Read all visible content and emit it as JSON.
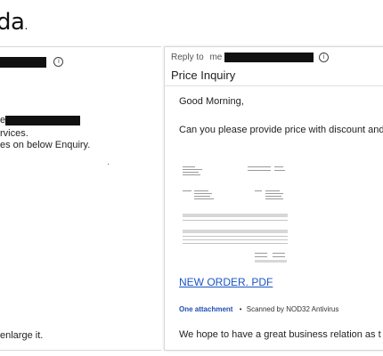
{
  "brand": {
    "logo_text": "da",
    "logo_dot": "."
  },
  "left_pane": {
    "line_1_suffix": "e",
    "line_2": "rvices.",
    "line_3": "es on below Enquiry.",
    "bullet": "·",
    "footer": "enlarge it."
  },
  "email": {
    "reply_to_label": "Reply to",
    "reply_to_me": "me",
    "subject": "Price Inquiry",
    "greeting": "Good Morning,",
    "body": "Can you please provide price with discount and lea",
    "attachment_link": "NEW ORDER. PDF",
    "attachment_count": "One attachment",
    "separator": "•",
    "scan_status": "Scanned by NOD32 Antivirus",
    "closing": "We hope to have a great business relation as t"
  },
  "colors": {
    "link": "#1a55c5",
    "attachment_label": "#1f4fb0",
    "redaction": "#111111"
  },
  "icons": {
    "info": "info-circle-icon"
  }
}
